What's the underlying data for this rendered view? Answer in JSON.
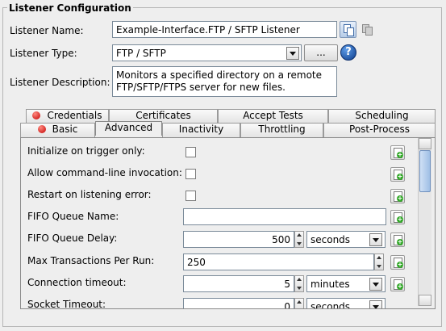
{
  "section_title": "Listener Configuration",
  "listener_name": {
    "label": "Listener Name:",
    "value": "Example-Interface.FTP / SFTP Listener"
  },
  "listener_type": {
    "label": "Listener Type:",
    "value": "FTP / SFTP",
    "browse_label": "...",
    "help_label": "?"
  },
  "listener_description": {
    "label": "Listener Description:",
    "line1": "Monitors a specified directory on a remote",
    "line2": "FTP/SFTP/FTPS server for new files."
  },
  "tabs_row1": [
    "Credentials",
    "Certificates",
    "Accept Tests",
    "Scheduling"
  ],
  "tabs_row2": [
    "Basic",
    "Advanced",
    "Inactivity",
    "Throttling",
    "Post-Process"
  ],
  "active_tab": "Advanced",
  "error_tabs": [
    "Credentials",
    "Basic"
  ],
  "advanced": {
    "initialize_on_trigger": {
      "label": "Initialize on trigger only:",
      "checked": false
    },
    "allow_cmdline": {
      "label": "Allow command-line invocation:",
      "checked": false
    },
    "restart_on_error": {
      "label": "Restart on listening error:",
      "checked": false
    },
    "fifo_queue_name": {
      "label": "FIFO Queue Name:",
      "value": ""
    },
    "fifo_queue_delay": {
      "label": "FIFO Queue Delay:",
      "value": "500",
      "unit": "seconds"
    },
    "max_transactions": {
      "label": "Max Transactions Per Run:",
      "value": "250"
    },
    "connection_timeout": {
      "label": "Connection timeout:",
      "value": "5",
      "unit": "minutes"
    },
    "socket_timeout": {
      "label": "Socket Timeout:",
      "value": "0",
      "unit": "seconds"
    }
  },
  "colors": {
    "error_dot": "#c40000",
    "add_plus": "#34a82a",
    "help": "#0d3d8c"
  }
}
